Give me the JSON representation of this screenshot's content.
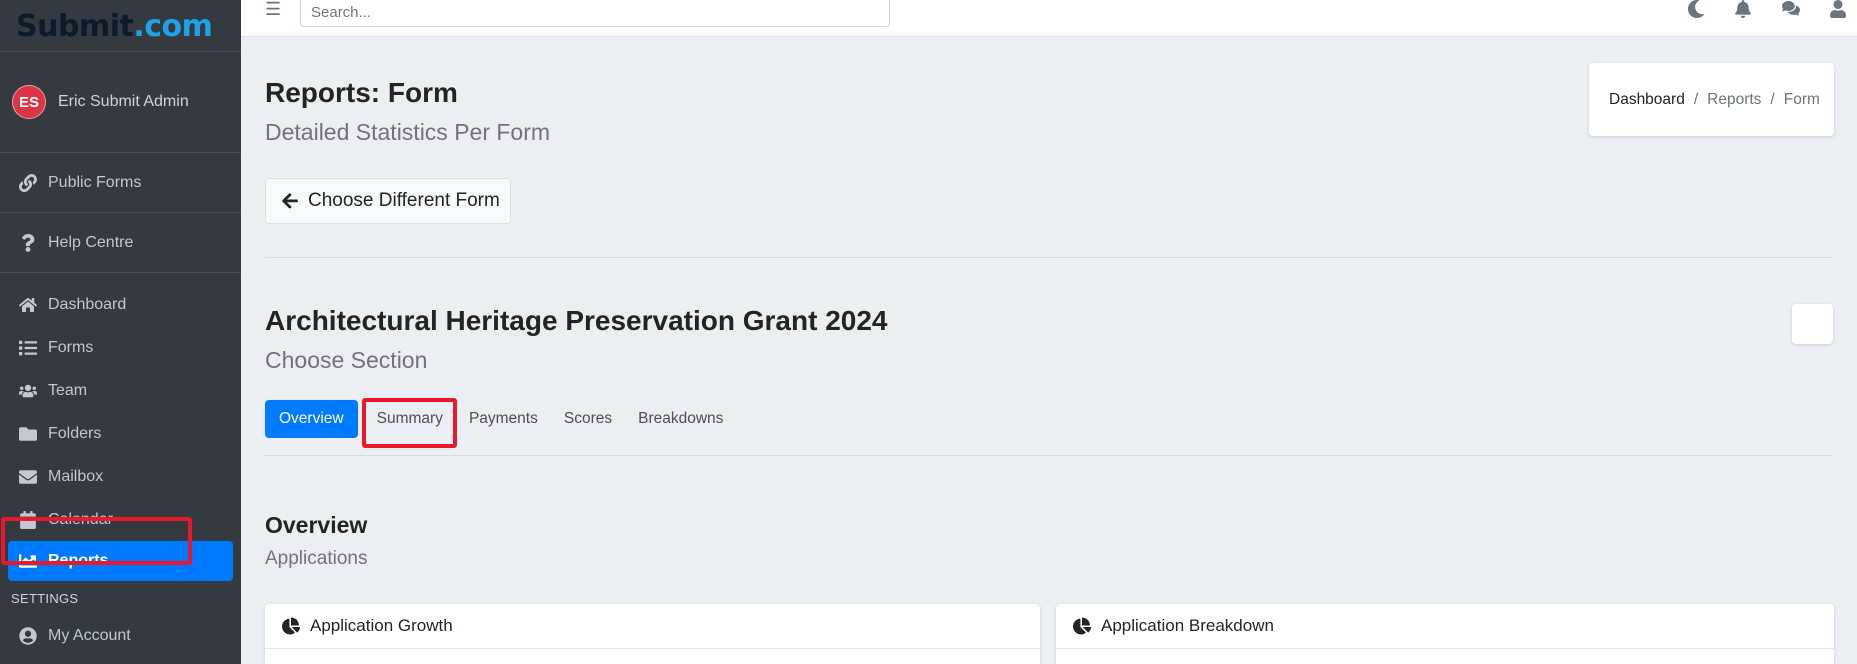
{
  "brand": {
    "name_main": "Submit",
    "name_dot": ".com"
  },
  "user": {
    "initials": "ES",
    "name": "Eric Submit Admin"
  },
  "sidebar": {
    "top_items": [
      {
        "label": "Public Forms",
        "icon": "link-icon"
      },
      {
        "label": "Help Centre",
        "icon": "question-icon"
      }
    ],
    "items": [
      {
        "label": "Dashboard",
        "icon": "home-icon"
      },
      {
        "label": "Forms",
        "icon": "list-icon"
      },
      {
        "label": "Team",
        "icon": "users-icon"
      },
      {
        "label": "Folders",
        "icon": "folder-icon"
      },
      {
        "label": "Mailbox",
        "icon": "envelope-icon"
      },
      {
        "label": "Calendar",
        "icon": "calendar-icon"
      },
      {
        "label": "Reports",
        "icon": "chart-bar-icon",
        "active": true
      }
    ],
    "settings_header": "SETTINGS",
    "settings_items": [
      {
        "label": "My Account",
        "icon": "user-circle-icon"
      }
    ]
  },
  "topbar": {
    "search_placeholder": "Search...",
    "icons": [
      "moon-icon",
      "bell-icon",
      "comments-icon",
      "user-icon"
    ]
  },
  "page": {
    "title": "Reports: Form",
    "subtitle": "Detailed Statistics Per Form",
    "back_button": "Choose Different Form"
  },
  "breadcrumb": [
    "Dashboard",
    "Reports",
    "Form"
  ],
  "form": {
    "title": "Architectural Heritage Preservation Grant 2024",
    "subtitle": "Choose Section"
  },
  "tabs": [
    "Overview",
    "Summary",
    "Payments",
    "Scores",
    "Breakdowns"
  ],
  "section": {
    "title": "Overview",
    "subtitle": "Applications"
  },
  "cards": [
    {
      "title": "Application Growth",
      "icon": "pie-chart-icon"
    },
    {
      "title": "Application Breakdown",
      "icon": "pie-chart-icon"
    }
  ],
  "colors": {
    "primary": "#007bff",
    "sidebar": "#343a40",
    "highlight": "#e8192c",
    "avatar": "#dc3545"
  }
}
